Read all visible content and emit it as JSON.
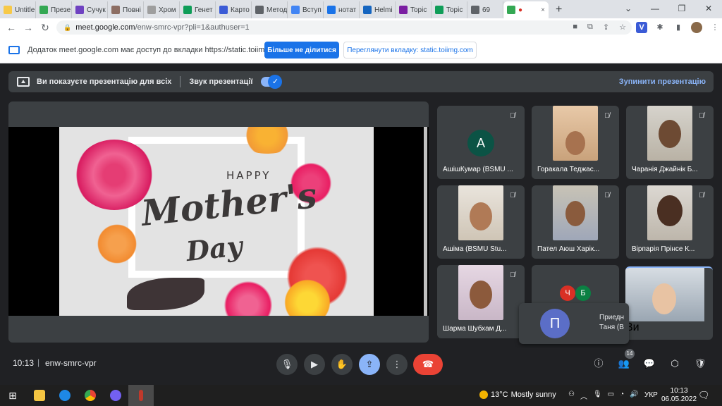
{
  "browser": {
    "tabs": [
      {
        "label": "Untitle",
        "color": "#f7c948"
      },
      {
        "label": "Презе",
        "color": "#34a853"
      },
      {
        "label": "Сучук",
        "color": "#6f42c1"
      },
      {
        "label": "Повні",
        "color": "#8d6e63"
      },
      {
        "label": "Хром",
        "color": "#9e9e9e"
      },
      {
        "label": "Генет",
        "color": "#0f9d58"
      },
      {
        "label": "Карто",
        "color": "#3b5bd6"
      },
      {
        "label": "Метод",
        "color": "#5f6368"
      },
      {
        "label": "Вступ",
        "color": "#4285f4"
      },
      {
        "label": "нотат",
        "color": "#1a73e8"
      },
      {
        "label": "Helmi",
        "color": "#1565c0"
      },
      {
        "label": "Topic",
        "color": "#7b1fa2"
      },
      {
        "label": "Topic",
        "color": "#0f9d58"
      },
      {
        "label": "69",
        "color": "#5f6368"
      }
    ],
    "active_tab_close": "×",
    "new_tab": "+",
    "window_controls": [
      "⌄",
      "—",
      "❐",
      "✕"
    ],
    "url_host": "meet.google.com",
    "url_path": "/enw-smrc-vpr?pli=1&authuser=1",
    "ext_v_label": "V"
  },
  "share_banner": {
    "message": "Додаток meet.google.com має доступ до вкладки https://static.toiimg.com",
    "stop_button": "Більше не ділитися",
    "view_tab_button": "Переглянути вкладку: static.toiimg.com"
  },
  "presenting": {
    "text": "Ви показуєте презентацію для всіх",
    "audio_label": "Звук презентації",
    "audio_on": true,
    "stop_label": "Зупинити презентацію"
  },
  "slide": {
    "happy": "HAPPY",
    "line1": "Mother's",
    "line2": "Day"
  },
  "participants": [
    {
      "name": "АшішКумар (BSMU ...",
      "initial": "А"
    },
    {
      "name": "Горакала Теджас..."
    },
    {
      "name": "Чаранія Джайнік Б..."
    },
    {
      "name": "Ашіма (BSMU Stu..."
    },
    {
      "name": "Пател Аюш Харік..."
    },
    {
      "name": "Вірпарія Прінсе К..."
    },
    {
      "name": "Шарма Шубхам Д..."
    }
  ],
  "overflow_tile": {
    "avatars": [
      {
        "letter": "Ч",
        "color": "#d93025"
      },
      {
        "letter": "Б",
        "color": "#0b8043"
      }
    ],
    "big_initial": "П",
    "name_line1": "Приедн",
    "name_line2": "Таня (B",
    "self_label": "Ви"
  },
  "meet_bar": {
    "time": "10:13",
    "separator": "|",
    "meeting_code": "enw-smrc-vpr",
    "people_count": "14"
  },
  "taskbar": {
    "start": "⊞",
    "temperature": "13°C",
    "weather": "Mostly sunny",
    "language": "УКР",
    "clock_time": "10:13",
    "clock_date": "06.05.2022"
  }
}
